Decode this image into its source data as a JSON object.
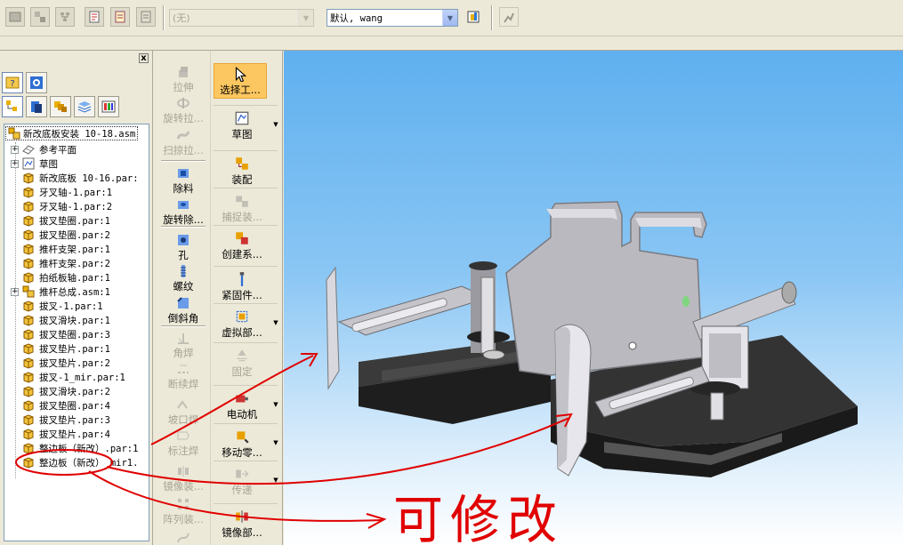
{
  "toolbar": {
    "style_combo_value": "(无)",
    "layer_combo_value": "默认, wang",
    "icons": [
      "part-icon",
      "assembly-icon",
      "tree-icon",
      "draft-icon",
      "properties-icon",
      "file-icon",
      "layer-settings-icon",
      "user-icon"
    ]
  },
  "tree_panel": {
    "close_label": "x",
    "tab_icons_row1": [
      "help-icon",
      "settings-icon"
    ],
    "tab_icons_row2": [
      "pathfinder-icon",
      "parts-library-icon",
      "family-icon",
      "layers-icon",
      "color-icon"
    ],
    "root_label": "新改底板安装 10-18.asm",
    "items": [
      {
        "label": "参考平面",
        "expander": "+",
        "icon": "reference-planes-icon"
      },
      {
        "label": "草图",
        "expander": "+",
        "icon": "sketch-icon"
      },
      {
        "label": "新改底板 10-16.par:",
        "expander": "",
        "icon": "part-icon"
      },
      {
        "label": "牙叉轴-1.par:1",
        "expander": "",
        "icon": "part-icon"
      },
      {
        "label": "牙叉轴-1.par:2",
        "expander": "",
        "icon": "part-icon"
      },
      {
        "label": "拔叉垫圈.par:1",
        "expander": "",
        "icon": "part-icon"
      },
      {
        "label": "拔叉垫圈.par:2",
        "expander": "",
        "icon": "part-icon"
      },
      {
        "label": "推杆支架.par:1",
        "expander": "",
        "icon": "part-icon"
      },
      {
        "label": "推杆支架.par:2",
        "expander": "",
        "icon": "part-icon"
      },
      {
        "label": "拍纸板轴.par:1",
        "expander": "",
        "icon": "part-icon"
      },
      {
        "label": "推杆总成.asm:1",
        "expander": "+",
        "icon": "subassembly-icon"
      },
      {
        "label": "拔叉-1.par:1",
        "expander": "",
        "icon": "part-icon"
      },
      {
        "label": "拔叉滑块.par:1",
        "expander": "",
        "icon": "part-icon"
      },
      {
        "label": "拔叉垫圈.par:3",
        "expander": "",
        "icon": "part-icon"
      },
      {
        "label": "拔叉垫片.par:1",
        "expander": "",
        "icon": "part-icon"
      },
      {
        "label": "拔叉垫片.par:2",
        "expander": "",
        "icon": "part-icon"
      },
      {
        "label": "拔叉-1_mir.par:1",
        "expander": "",
        "icon": "part-icon"
      },
      {
        "label": "拔叉滑块.par:2",
        "expander": "",
        "icon": "part-icon"
      },
      {
        "label": "拔叉垫圈.par:4",
        "expander": "",
        "icon": "part-icon"
      },
      {
        "label": "拔叉垫片.par:3",
        "expander": "",
        "icon": "part-icon"
      },
      {
        "label": "拔叉垫片.par:4",
        "expander": "",
        "icon": "part-icon"
      },
      {
        "label": "整边板（新改）.par:1",
        "expander": "",
        "icon": "part-icon"
      },
      {
        "label": "整边板（新改）_mir1.",
        "expander": "",
        "icon": "part-icon"
      }
    ]
  },
  "feature_commands": [
    {
      "label": "拉伸",
      "icon": "extrude-icon",
      "enabled": false
    },
    {
      "label": "旋转拉...",
      "icon": "revolve-protrusion-icon",
      "enabled": false
    },
    {
      "label": "扫掠拉...",
      "icon": "sweep-protrusion-icon",
      "enabled": false
    },
    {
      "label": "除料",
      "icon": "cutout-icon",
      "enabled": true
    },
    {
      "label": "旋转除...",
      "icon": "revolved-cutout-icon",
      "enabled": true
    },
    {
      "label": "孔",
      "icon": "hole-icon",
      "enabled": true
    },
    {
      "label": "螺纹",
      "icon": "thread-icon",
      "enabled": true
    },
    {
      "label": "倒斜角",
      "icon": "chamfer-icon",
      "enabled": true
    },
    {
      "label": "角焊",
      "icon": "fillet-weld-icon",
      "enabled": false
    },
    {
      "label": "断续焊",
      "icon": "intermittent-weld-icon",
      "enabled": false
    },
    {
      "label": "坡口焊",
      "icon": "groove-weld-icon",
      "enabled": false
    },
    {
      "label": "标注焊",
      "icon": "label-weld-icon",
      "enabled": false
    },
    {
      "label": "镜像装...",
      "icon": "mirror-assembly-icon",
      "enabled": false
    },
    {
      "label": "阵列装...",
      "icon": "pattern-assembly-icon",
      "enabled": false
    },
    {
      "label": "沿曲线",
      "icon": "along-curve-icon",
      "enabled": false
    }
  ],
  "assembly_commands": [
    {
      "label": "选择工...",
      "icon": "select-tool-icon",
      "enabled": true,
      "selected": true,
      "dropdown": false
    },
    {
      "label": "草图",
      "icon": "sketch-icon",
      "enabled": true,
      "selected": false,
      "dropdown": true
    },
    {
      "label": "装配",
      "icon": "assemble-icon",
      "enabled": true,
      "selected": false,
      "dropdown": false
    },
    {
      "label": "捕捉装...",
      "icon": "capture-fit-icon",
      "enabled": false,
      "selected": false,
      "dropdown": false
    },
    {
      "label": "创建系...",
      "icon": "create-system-icon",
      "enabled": true,
      "selected": false,
      "dropdown": false
    },
    {
      "label": "紧固件...",
      "icon": "fastener-icon",
      "enabled": true,
      "selected": false,
      "dropdown": false
    },
    {
      "label": "虚拟部...",
      "icon": "virtual-component-icon",
      "enabled": true,
      "selected": false,
      "dropdown": true
    },
    {
      "label": "固定",
      "icon": "ground-icon",
      "enabled": false,
      "selected": false,
      "dropdown": false
    },
    {
      "label": "电动机",
      "icon": "motor-icon",
      "enabled": true,
      "selected": false,
      "dropdown": true
    },
    {
      "label": "移动零...",
      "icon": "move-parts-icon",
      "enabled": true,
      "selected": false,
      "dropdown": true
    },
    {
      "label": "传递",
      "icon": "transfer-icon",
      "enabled": false,
      "selected": false,
      "dropdown": true
    },
    {
      "label": "镜像部...",
      "icon": "mirror-component-icon",
      "enabled": true,
      "selected": false,
      "dropdown": false
    }
  ],
  "annotation": {
    "text": "可修改",
    "color": "#e00000"
  },
  "colors": {
    "viewport_top": "#5fb0ef",
    "viewport_bottom": "#ffffff",
    "selected_button": "#fcc760",
    "model_plate": "#2f2f2f",
    "model_metal": "#c8c8cc"
  }
}
